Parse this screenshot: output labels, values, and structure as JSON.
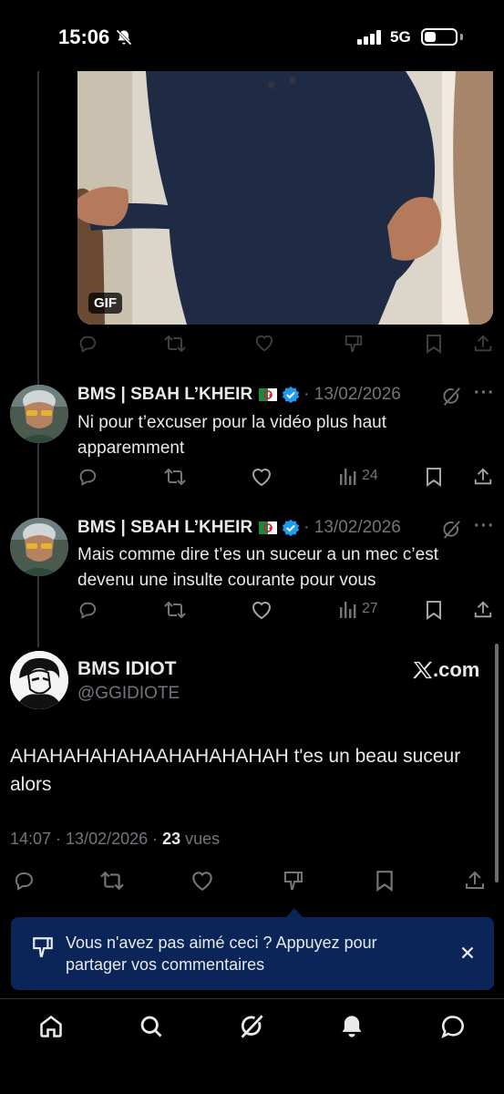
{
  "status_bar": {
    "time": "15:06",
    "network": "5G"
  },
  "gif_tweet": {
    "badge": "GIF"
  },
  "replies": [
    {
      "name": "BMS | SBAH L’KHEIR",
      "date": "· 13/02/2026",
      "text": "Ni pour t’excuser pour la vidéo plus haut apparemment",
      "views": "24"
    },
    {
      "name": "BMS | SBAH L’KHEIR",
      "date": "· 13/02/2026",
      "text": "Mais comme dire t’es un suceur a un mec c’est devenu une insulte courante pour vous",
      "views": "27"
    }
  ],
  "main_tweet": {
    "name": "BMS IDIOT",
    "handle": "@GGIDIOTE",
    "source": ".com",
    "text": "AHAHAHAHAHAAHAHAHAHAH t'es un beau suceur alors",
    "time": "14:07 · 13/02/2026 · ",
    "views_count": "23",
    "views_label": " vues"
  },
  "feedback_banner": {
    "text": "Vous n'avez pas aimé ceci ? Appuyez pour partager vos commentaires"
  },
  "icons": {
    "reply": "reply-icon",
    "repost": "repost-icon",
    "like": "heart-icon",
    "dislike": "dislike-icon",
    "views": "views-icon",
    "bookmark": "bookmark-icon",
    "share": "share-icon",
    "grok": "grok-icon",
    "home": "home-icon",
    "search": "search-icon",
    "notifications": "bell-icon",
    "messages": "messages-icon"
  },
  "colors": {
    "background": "#000000",
    "muted": "#71767b",
    "verified": "#1d9bf0",
    "banner": "#0b2559"
  }
}
